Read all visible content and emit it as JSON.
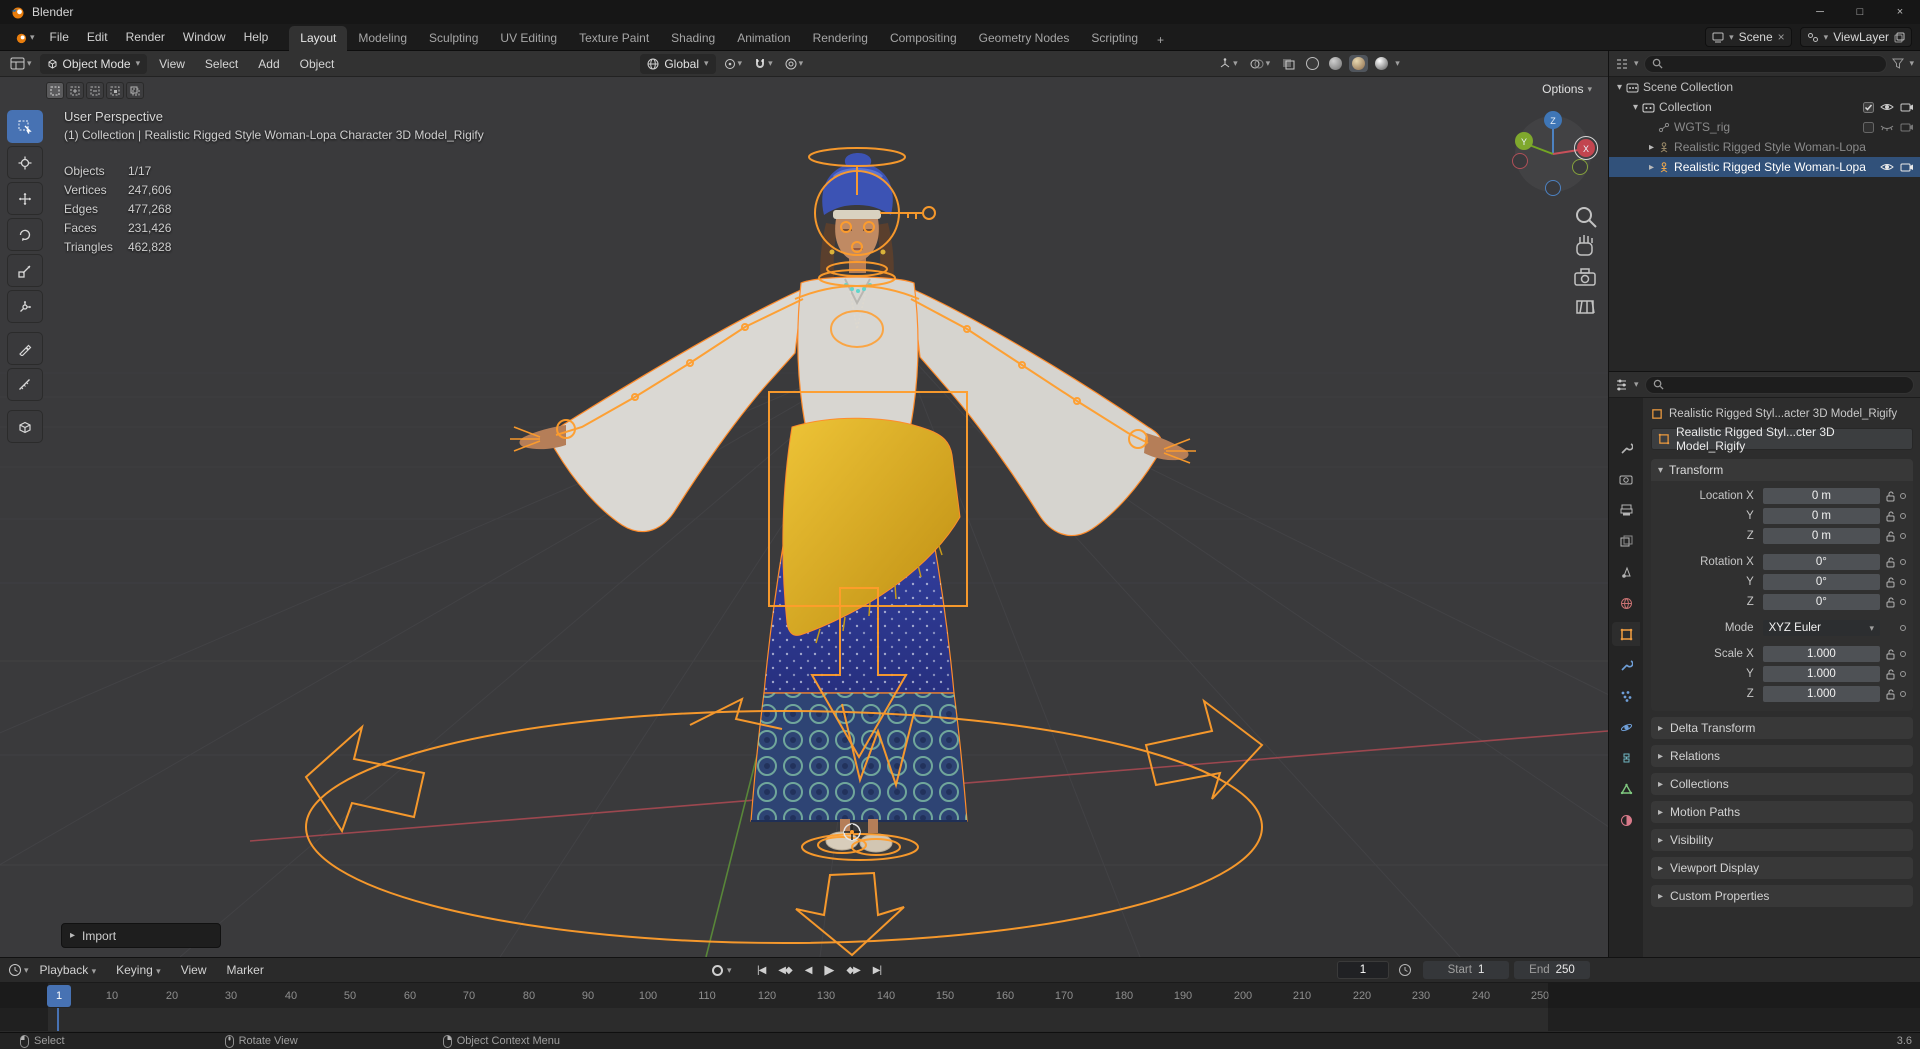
{
  "colors": {
    "accent": "#4772b3",
    "selection_outline": "#ff9d2c"
  },
  "icons": {
    "minimize": "─",
    "maximize": "□",
    "close": "×",
    "chevron_down": "▾",
    "arrow_right": "▸",
    "arrow_down": "▾",
    "jump_start": "|◀",
    "prev_keyframe": "◀◆",
    "play_reverse": "◀",
    "play": "▶",
    "next_keyframe": "◆▶",
    "jump_end": "▶|",
    "new_tab": "+"
  },
  "window": {
    "title": "Blender",
    "version": "3.6"
  },
  "menubar": {
    "menus": [
      "File",
      "Edit",
      "Render",
      "Window",
      "Help"
    ],
    "workspaces": [
      "Layout",
      "Modeling",
      "Sculpting",
      "UV Editing",
      "Texture Paint",
      "Shading",
      "Animation",
      "Rendering",
      "Compositing",
      "Geometry Nodes",
      "Scripting"
    ],
    "scene_label": "Scene",
    "viewlayer_label": "ViewLayer"
  },
  "viewport_header": {
    "mode": "Object Mode",
    "menus": [
      "View",
      "Select",
      "Add",
      "Object"
    ],
    "orientation": "Global",
    "options_label": "Options"
  },
  "viewport": {
    "view_label": "User Perspective",
    "context_label": "(1) Collection | Realistic Rigged Style Woman-Lopa Character 3D Model_Rigify",
    "stats": [
      {
        "label": "Objects",
        "value": "1/17"
      },
      {
        "label": "Vertices",
        "value": "247,606"
      },
      {
        "label": "Edges",
        "value": "477,268"
      },
      {
        "label": "Faces",
        "value": "231,426"
      },
      {
        "label": "Triangles",
        "value": "462,828"
      }
    ],
    "import_label": "Import",
    "gizmo": {
      "x": "X",
      "y": "Y",
      "z": "Z"
    }
  },
  "outliner": {
    "rows": [
      {
        "label": "Scene Collection"
      },
      {
        "label": "Collection"
      },
      {
        "label": "WGTS_rig"
      },
      {
        "label": "Realistic Rigged Style Woman-Lopa"
      },
      {
        "label": "Realistic Rigged Style Woman-Lopa"
      }
    ]
  },
  "properties": {
    "breadcrumb": "Realistic Rigged Styl...acter 3D Model_Rigify",
    "object_name": "Realistic Rigged Styl...cter 3D Model_Rigify",
    "transform": {
      "title": "Transform",
      "rows": [
        {
          "label": "Location X",
          "value": "0 m"
        },
        {
          "label": "Y",
          "value": "0 m"
        },
        {
          "label": "Z",
          "value": "0 m"
        },
        {
          "label": "Rotation X",
          "value": "0°"
        },
        {
          "label": "Y",
          "value": "0°"
        },
        {
          "label": "Z",
          "value": "0°"
        },
        {
          "label": "Scale X",
          "value": "1.000"
        },
        {
          "label": "Y",
          "value": "1.000"
        },
        {
          "label": "Z",
          "value": "1.000"
        }
      ],
      "mode_label": "Mode",
      "mode_value": "XYZ Euler"
    },
    "sections": [
      "Delta Transform",
      "Relations",
      "Collections",
      "Motion Paths",
      "Visibility",
      "Viewport Display",
      "Custom Properties"
    ]
  },
  "timeline": {
    "menus": [
      "Playback",
      "Keying",
      "View",
      "Marker"
    ],
    "current_frame": "1",
    "start_label": "Start",
    "start_value": "1",
    "end_label": "End",
    "end_value": "250",
    "ticks": [
      "10",
      "20",
      "30",
      "40",
      "50",
      "60",
      "70",
      "80",
      "90",
      "100",
      "110",
      "120",
      "130",
      "140",
      "150",
      "160",
      "170",
      "180",
      "190",
      "200",
      "210",
      "220",
      "230",
      "240",
      "250"
    ]
  },
  "statusbar": {
    "items": [
      "Select",
      "Rotate View",
      "Object Context Menu"
    ],
    "version": "3.6"
  }
}
